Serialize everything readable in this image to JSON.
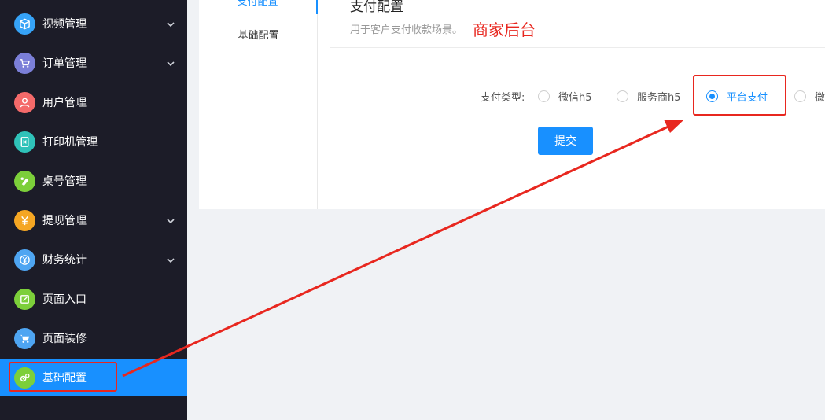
{
  "sidebar": {
    "items": [
      {
        "label": "视频管理",
        "icon": "cube-icon",
        "icon_color": "#36a3f7",
        "has_submenu": true,
        "active": false
      },
      {
        "label": "订单管理",
        "icon": "cart-icon",
        "icon_color": "#7b7fd8",
        "has_submenu": true,
        "active": false
      },
      {
        "label": "用户管理",
        "icon": "user-icon",
        "icon_color": "#f46a6a",
        "has_submenu": false,
        "active": false
      },
      {
        "label": "打印机管理",
        "icon": "printer-document-icon",
        "icon_color": "#2fc2b9",
        "has_submenu": false,
        "active": false
      },
      {
        "label": "桌号管理",
        "icon": "table-tag-icon",
        "icon_color": "#7ccf3a",
        "has_submenu": false,
        "active": false
      },
      {
        "label": "提现管理",
        "icon": "yuan-icon",
        "icon_color": "#f5a623",
        "has_submenu": true,
        "active": false
      },
      {
        "label": "财务统计",
        "icon": "finance-icon",
        "icon_color": "#4ea5f2",
        "has_submenu": true,
        "active": false
      },
      {
        "label": "页面入口",
        "icon": "edit-icon",
        "icon_color": "#7ccf3a",
        "has_submenu": false,
        "active": false
      },
      {
        "label": "页面装修",
        "icon": "shopping-cart-icon",
        "icon_color": "#4ea5f2",
        "has_submenu": false,
        "active": false
      },
      {
        "label": "基础配置",
        "icon": "settings-gears-icon",
        "icon_color": "#7ccf3a",
        "has_submenu": false,
        "active": true
      }
    ]
  },
  "subnav": {
    "items": [
      {
        "label": "支付配置",
        "active": true
      },
      {
        "label": "基础配置",
        "active": false
      }
    ]
  },
  "section": {
    "title": "支付配置",
    "description": "用于客户支付收款场景。"
  },
  "annotation": {
    "text": "商家后台",
    "color": "#e8271f"
  },
  "form": {
    "pay_type_label": "支付类型:",
    "options": [
      {
        "label": "微信h5",
        "checked": false
      },
      {
        "label": "服务商h5",
        "checked": false
      },
      {
        "label": "平台支付",
        "checked": true
      },
      {
        "label": "微",
        "checked": false
      }
    ],
    "submit_label": "提交"
  },
  "colors": {
    "primary": "#1890ff",
    "sidebar_bg": "#1c1c28",
    "annotation": "#e8271f"
  }
}
